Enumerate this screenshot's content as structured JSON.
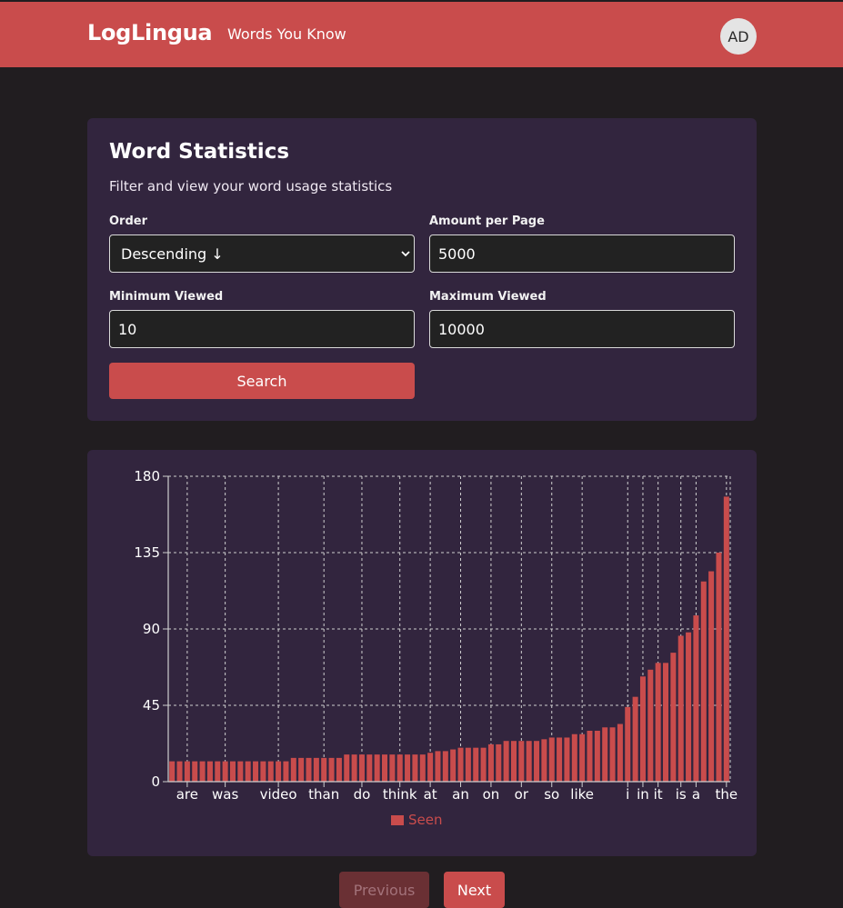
{
  "header": {
    "brand": "LogLingua",
    "nav_link": "Words You Know",
    "avatar_initials": "AD",
    "color": "#c94c4c"
  },
  "filter": {
    "title": "Word Statistics",
    "subtitle": "Filter and view your word usage statistics",
    "order_label": "Order",
    "order_value": "Descending ↓",
    "amount_label": "Amount per Page",
    "amount_value": "5000",
    "min_label": "Minimum Viewed",
    "min_value": "10",
    "max_label": "Maximum Viewed",
    "max_value": "10000",
    "search_label": "Search"
  },
  "pagination": {
    "previous_label": "Previous",
    "next_label": "Next"
  },
  "chart_data": {
    "type": "bar",
    "series": [
      {
        "name": "Seen",
        "color": "#c94c4c",
        "values": [
          12,
          12,
          12,
          12,
          12,
          12,
          12,
          12,
          12,
          12,
          12,
          12,
          12,
          12,
          12,
          12,
          14,
          14,
          14,
          14,
          14,
          14,
          14,
          16,
          16,
          16,
          16,
          16,
          16,
          16,
          16,
          16,
          16,
          16,
          17,
          18,
          18,
          19,
          20,
          20,
          20,
          20,
          22,
          22,
          24,
          24,
          24,
          24,
          24,
          25,
          26,
          26,
          26,
          28,
          28,
          30,
          30,
          32,
          32,
          34,
          44,
          50,
          62,
          66,
          70,
          70,
          76,
          86,
          88,
          98,
          118,
          124,
          135,
          168
        ]
      }
    ],
    "category_labels": [
      {
        "index": 2,
        "label": "are"
      },
      {
        "index": 7,
        "label": "was"
      },
      {
        "index": 14,
        "label": "video"
      },
      {
        "index": 20,
        "label": "than"
      },
      {
        "index": 25,
        "label": "do"
      },
      {
        "index": 30,
        "label": "think"
      },
      {
        "index": 34,
        "label": "at"
      },
      {
        "index": 38,
        "label": "an"
      },
      {
        "index": 42,
        "label": "on"
      },
      {
        "index": 46,
        "label": "or"
      },
      {
        "index": 50,
        "label": "so"
      },
      {
        "index": 54,
        "label": "like"
      },
      {
        "index": 60,
        "label": "i"
      },
      {
        "index": 62,
        "label": "in"
      },
      {
        "index": 64,
        "label": "it"
      },
      {
        "index": 67,
        "label": "is"
      },
      {
        "index": 69,
        "label": "a"
      },
      {
        "index": 73,
        "label": "the"
      }
    ],
    "yticks": [
      0,
      45,
      90,
      135,
      180
    ],
    "ylim": [
      0,
      180
    ],
    "grid": true,
    "legend": "bottom-center"
  }
}
